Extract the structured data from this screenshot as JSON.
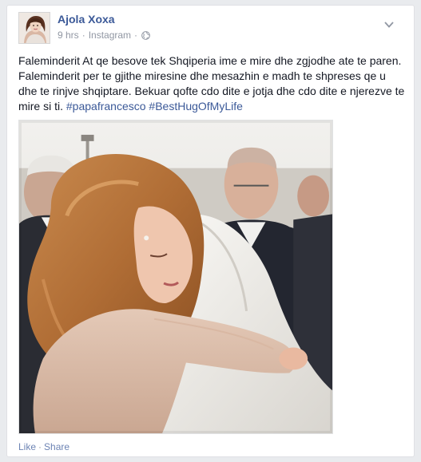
{
  "post": {
    "author": "Ajola Xoxa",
    "time": "9 hrs",
    "source": "Instagram",
    "privacy_icon": "globe-icon",
    "text_parts": [
      {
        "kind": "text",
        "value": "Faleminderit At qe besove tek Shqiperia ime e mire dhe zgjodhe ate te paren. Faleminderit per te gjithe miresine dhe mesazhin e madh te shpreses qe u dhe te rinjve shqiptare. Bekuar qofte cdo dite e jotja dhe cdo dite e njerezve te mire si ti. "
      },
      {
        "kind": "hashtag",
        "value": "#papafrancesco"
      },
      {
        "kind": "text",
        "value": " "
      },
      {
        "kind": "hashtag",
        "value": "#BestHugOfMyLife"
      }
    ],
    "menu_icon": "chevron-down-icon"
  },
  "actions": {
    "like": "Like",
    "separator": "·",
    "share": "Share"
  },
  "colors": {
    "link": "#3b5998",
    "meta": "#9197a3",
    "background": "#e9ebee"
  }
}
